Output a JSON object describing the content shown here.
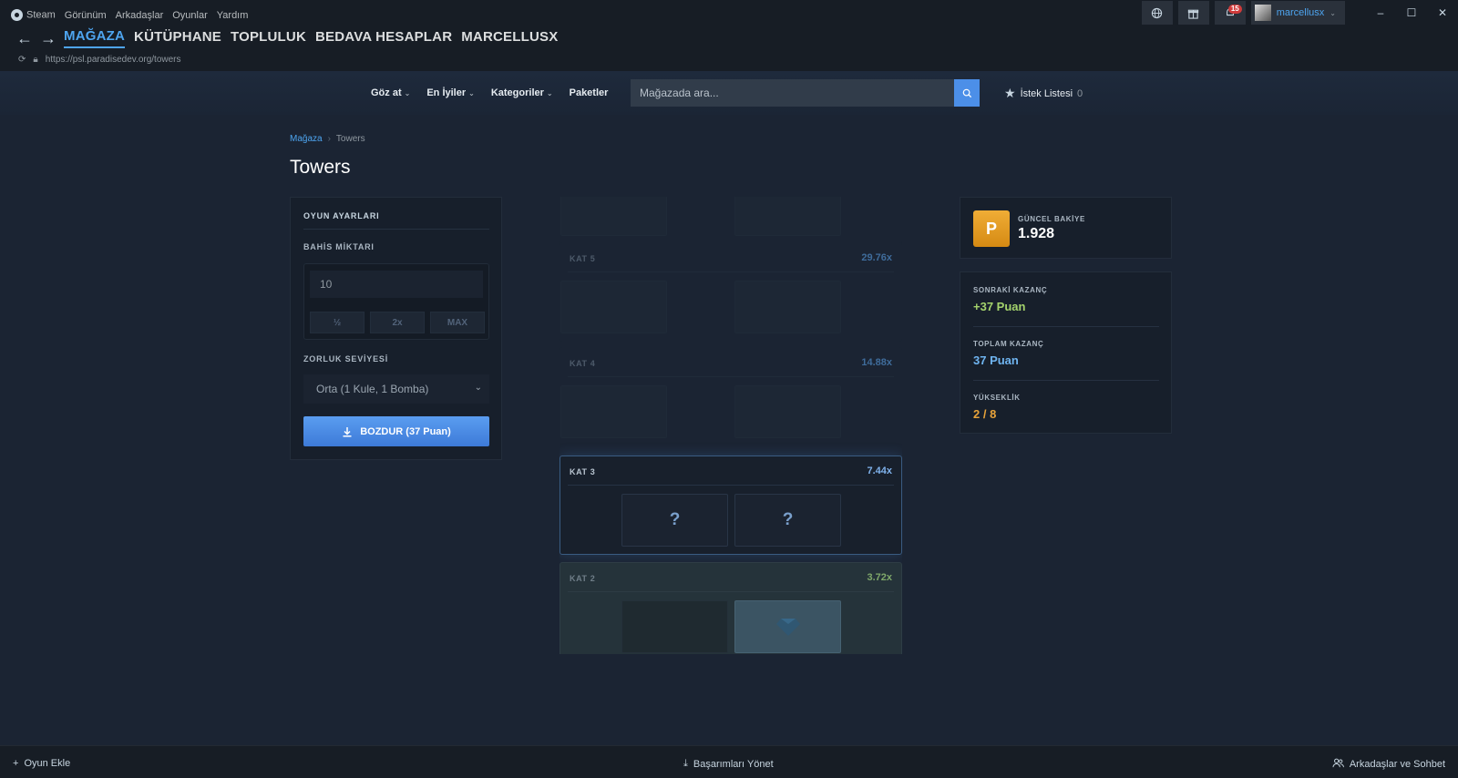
{
  "menu": {
    "steam": "Steam",
    "view": "Görünüm",
    "friends": "Arkadaşlar",
    "games": "Oyunlar",
    "help": "Yardım"
  },
  "nav": {
    "store": "MAĞAZA",
    "library": "KÜTÜPHANE",
    "community": "TOPLULUK",
    "free_accounts": "BEDAVA HESAPLAR",
    "profile": "MARCELLUSX"
  },
  "url": "https://psl.paradisedev.org/towers",
  "notifications_count": "15",
  "username": "marcellusx",
  "store_header": {
    "browse": "Göz at",
    "top": "En İyiler",
    "categories": "Kategoriler",
    "bundles": "Paketler",
    "search_placeholder": "Mağazada ara...",
    "wishlist_label": "İstek Listesi",
    "wishlist_count": "0"
  },
  "breadcrumb": {
    "store": "Mağaza",
    "current": "Towers"
  },
  "page_title": "Towers",
  "settings": {
    "heading": "OYUN AYARLARI",
    "bet_label": "BAHİS MİKTARI",
    "bet_value": "10",
    "half_btn": "½",
    "double_btn": "2x",
    "max_btn": "MAX",
    "difficulty_label": "ZORLUK SEVİYESİ",
    "difficulty_value": "Orta (1 Kule, 1 Bomba)",
    "cashout_label": "BOZDUR (37 Puan)"
  },
  "tower": {
    "floors": [
      {
        "label": "KAT 5",
        "multiplier": "29.76x",
        "state": "locked"
      },
      {
        "label": "KAT 4",
        "multiplier": "14.88x",
        "state": "locked"
      },
      {
        "label": "KAT 3",
        "multiplier": "7.44x",
        "state": "active",
        "tile_text": "?"
      },
      {
        "label": "KAT 2",
        "multiplier": "3.72x",
        "state": "cleared"
      }
    ]
  },
  "balance": {
    "label": "GÜNCEL BAKİYE",
    "value": "1.928",
    "badge": "P"
  },
  "stats": {
    "next_win_label": "SONRAKİ KAZANÇ",
    "next_win_value": "+37 Puan",
    "total_win_label": "TOPLAM KAZANÇ",
    "total_win_value": "37 Puan",
    "height_label": "YÜKSEKLİK",
    "height_value": "2 / 8"
  },
  "colors": {
    "accent": "#4ea5f0",
    "next_win": "#a4d36c",
    "total_win": "#6fb4f0",
    "height": "#e8a33a"
  },
  "footer": {
    "add_game": "Oyun Ekle",
    "manage_achievements": "Başarımları Yönet",
    "friends_chat": "Arkadaşlar ve Sohbet"
  }
}
